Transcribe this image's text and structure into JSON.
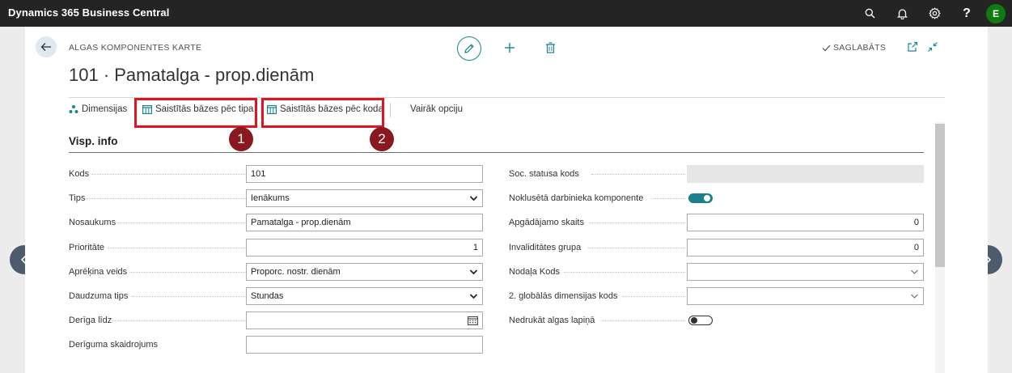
{
  "topbar": {
    "app_title": "Dynamics 365 Business Central",
    "icons": [
      "search-icon",
      "bell-icon",
      "gear-icon",
      "help-icon"
    ],
    "help_glyph": "?",
    "avatar_initial": "E"
  },
  "header": {
    "caption": "ALGAS KOMPONENTES KARTE",
    "title": "101 · Pamatalga - prop.dienām",
    "saved_label": "SAGLABĀTS"
  },
  "actions": {
    "dimensions": "Dimensijas",
    "related_by_type": "Saistītās bāzes pēc tipa",
    "related_by_code": "Saistītās bāzes pēc koda",
    "more_options": "Vairāk opciju"
  },
  "badges": {
    "first": "1",
    "second": "2"
  },
  "section": {
    "title": "Visp. info"
  },
  "left_fields": {
    "code": {
      "label": "Kods",
      "value": "101"
    },
    "type": {
      "label": "Tips",
      "value": "Ienākums"
    },
    "name": {
      "label": "Nosaukums",
      "value": "Pamatalga - prop.dienām"
    },
    "priority": {
      "label": "Prioritāte",
      "value": "1"
    },
    "calc_method": {
      "label": "Aprēķina veids",
      "value": "Proporc. nostr. dienām"
    },
    "qty_type": {
      "label": "Daudzuma tips",
      "value": "Stundas"
    },
    "valid_until": {
      "label": "Derīga līdz",
      "value": ""
    },
    "validity_note": {
      "label": "Derīguma skaidrojums",
      "value": ""
    }
  },
  "right_fields": {
    "soc_status": {
      "label": "Soc. statusa kods",
      "value": ""
    },
    "default_component": {
      "label": "Noklusētā darbinieka komponente",
      "on": true
    },
    "dependents": {
      "label": "Apgādājamo skaits",
      "value": "0"
    },
    "disability_group": {
      "label": "Invaliditātes grupa",
      "value": "0"
    },
    "department_code": {
      "label": "Nodaļa Kods",
      "value": ""
    },
    "global_dim2": {
      "label": "2. globālās dimensijas kods",
      "value": ""
    },
    "no_print_payslip": {
      "label": "Nedrukāt algas lapiņā",
      "on": false
    }
  },
  "colors": {
    "accent": "#1c8391",
    "highlight": "#e0141e",
    "badge": "#8a1820",
    "topbar": "#242424",
    "avatar": "#107c10"
  }
}
